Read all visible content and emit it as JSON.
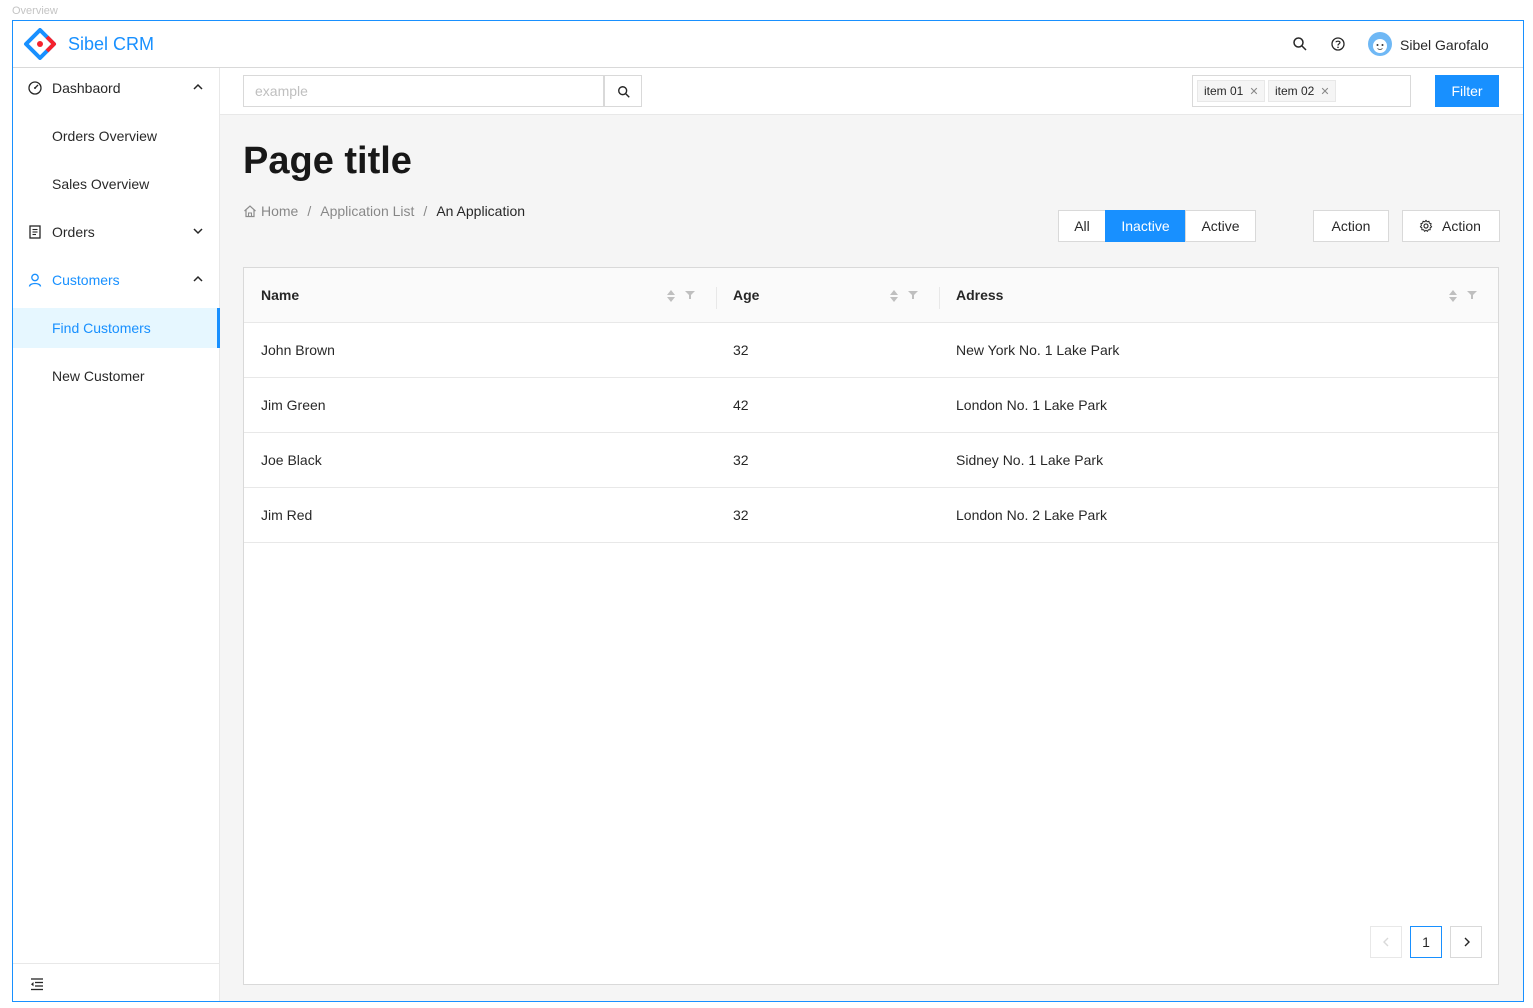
{
  "frame_label": "Overview",
  "header": {
    "app_title": "Sibel CRM",
    "user_name": "Sibel Garofalo",
    "icons": [
      "search-icon",
      "help-icon",
      "avatar"
    ],
    "brand_color": "#1890ff"
  },
  "sidebar": {
    "items": [
      {
        "label": "Dashbaord",
        "icon": "dashboard-icon",
        "expanded": true
      },
      {
        "label": "Orders Overview"
      },
      {
        "label": "Sales Overview"
      },
      {
        "label": "Orders",
        "icon": "orders-icon",
        "expanded": false
      },
      {
        "label": "Customers",
        "icon": "user-icon",
        "expanded": true,
        "active": true
      },
      {
        "label": "Find Customers",
        "selected": true
      },
      {
        "label": "New Customer"
      }
    ]
  },
  "toolbar": {
    "search_placeholder": "example",
    "tags": [
      "item 01",
      "item 02"
    ],
    "filter_label": "Filter"
  },
  "page": {
    "title": "Page title",
    "breadcrumb": [
      "Home",
      "Application List",
      "An Application"
    ],
    "segments": [
      "All",
      "Inactive",
      "Active"
    ],
    "selected_segment": "Inactive",
    "action1_label": "Action",
    "action2_label": "Action"
  },
  "table": {
    "columns": [
      "Name",
      "Age",
      "Adress"
    ],
    "rows": [
      {
        "name": "John Brown",
        "age": "32",
        "address": "New York No. 1 Lake Park"
      },
      {
        "name": "Jim Green",
        "age": "42",
        "address": "London No. 1 Lake Park"
      },
      {
        "name": "Joe Black",
        "age": "32",
        "address": "Sidney No. 1 Lake Park"
      },
      {
        "name": "Jim Red",
        "age": "32",
        "address": "London No. 2 Lake Park"
      }
    ]
  },
  "pagination": {
    "current_page": "1"
  }
}
